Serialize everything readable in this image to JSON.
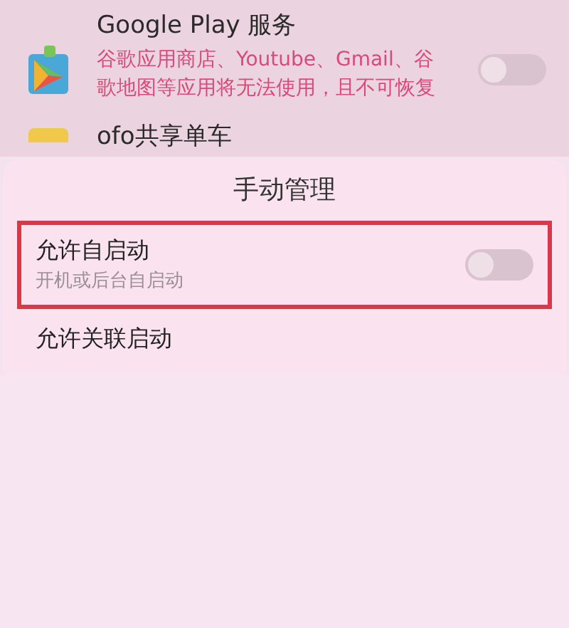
{
  "apps": [
    {
      "name": "Google Play 服务",
      "warning": "谷歌应用商店、Youtube、Gmail、谷歌地图等应用将无法使用，且不可恢复",
      "on": false
    },
    {
      "name": "ofo共享单车"
    }
  ],
  "dialog": {
    "title": "手动管理",
    "options": [
      {
        "label": "允许自启动",
        "description": "开机或后台自启动",
        "on": false,
        "highlighted": true
      },
      {
        "label": "允许关联启动"
      }
    ]
  }
}
